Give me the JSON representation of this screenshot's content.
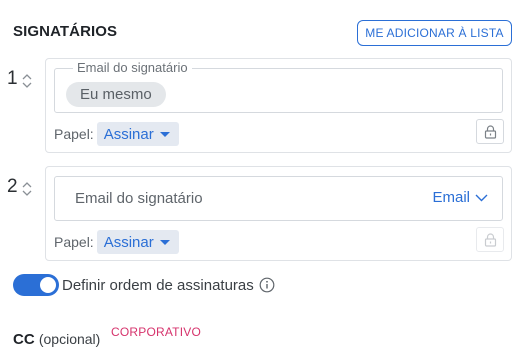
{
  "header": {
    "title": "SIGNATÁRIOS",
    "add_me_label": "ME ADICIONAR À LISTA"
  },
  "signers": [
    {
      "order": "1",
      "email_label": "Email do signatário",
      "email_chip": "Eu mesmo",
      "role_label": "Papel:",
      "role_value": "Assinar",
      "lock_icon": "lock-icon"
    },
    {
      "order": "2",
      "email_placeholder": "Email do signatário",
      "email_type": "Email",
      "role_label": "Papel:",
      "role_value": "Assinar",
      "lock_icon": "lock-icon"
    }
  ],
  "order_toggle": {
    "label": "Definir ordem de assinaturas",
    "enabled": true
  },
  "cc": {
    "label": "CC",
    "optional": "(opcional)",
    "badge": "CORPORATIVO"
  },
  "colors": {
    "accent": "#2b6fd6",
    "badge": "#d6336c",
    "chip_bg": "#e4e7ea"
  }
}
